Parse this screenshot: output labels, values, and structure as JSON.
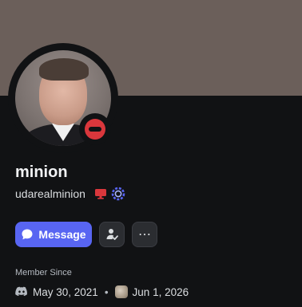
{
  "profile": {
    "display_name": "minion",
    "username": "udarealminion",
    "status": "do-not-disturb",
    "banner_color": "#6b5f5a",
    "badges": [
      {
        "icon": "monitor-icon",
        "color": "#da373c"
      },
      {
        "icon": "gear-badge-icon",
        "color": "#5865f2"
      }
    ]
  },
  "actions": {
    "message_label": "Message",
    "message_icon": "chat-bubble-icon",
    "friend_icon": "add-friend-icon",
    "more_label": "⋯"
  },
  "member_since": {
    "title": "Member Since",
    "discord_date": "May 30, 2021",
    "separator": "•",
    "server_date": "Jun 1, 2026"
  },
  "colors": {
    "background": "#111214",
    "accent": "#5865f2",
    "dnd": "#da373c"
  }
}
